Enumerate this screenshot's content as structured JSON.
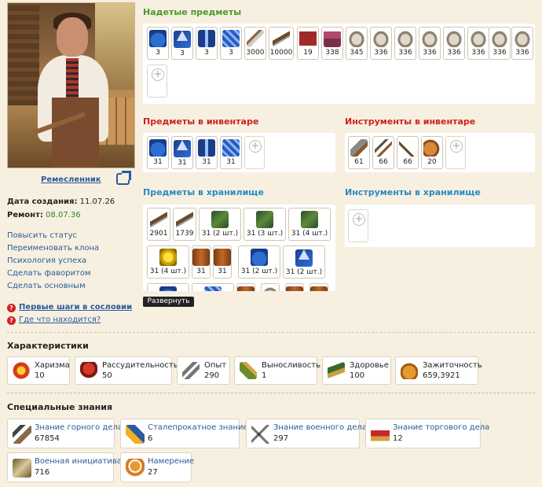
{
  "profile": {
    "class_link": "Ремесленник",
    "created_label": "Дата создания:",
    "created_value": "11.07.26",
    "repair_label": "Ремонт:",
    "repair_value": "08.07.36",
    "actions": [
      "Повысить статус",
      "Переименовать клона",
      "Психология успеха",
      "Сделать фаворитом",
      "Сделать основным"
    ],
    "help": [
      "Первые шаги в сословии",
      "Где что находится?"
    ]
  },
  "equipped": {
    "title": "Надетые предметы",
    "items": [
      {
        "icon": "blue-cap-icon",
        "count": "3"
      },
      {
        "icon": "blue-triangle-icon",
        "count": "3"
      },
      {
        "icon": "blue-vest-icon",
        "count": "3"
      },
      {
        "icon": "blue-box-icon",
        "count": "3"
      },
      {
        "icon": "sword-icon",
        "count": "3000"
      },
      {
        "icon": "rifle-icon",
        "count": "10000"
      },
      {
        "icon": "red-coat-icon",
        "count": "19"
      },
      {
        "icon": "dress-icon",
        "count": "338"
      },
      {
        "icon": "ring-icon",
        "count": "345"
      },
      {
        "icon": "ring-icon",
        "count": "336"
      },
      {
        "icon": "ring-icon",
        "count": "336"
      },
      {
        "icon": "ring-icon",
        "count": "336"
      },
      {
        "icon": "ring-icon",
        "count": "336"
      },
      {
        "icon": "ring-icon",
        "count": "336"
      },
      {
        "icon": "ring-icon",
        "count": "336"
      },
      {
        "icon": "ring-icon",
        "count": "336"
      }
    ]
  },
  "inventory": {
    "title": "Предметы в инвентаре",
    "items": [
      {
        "icon": "blue-cap-icon",
        "count": "31"
      },
      {
        "icon": "blue-triangle-icon",
        "count": "31"
      },
      {
        "icon": "blue-vest-icon",
        "count": "31"
      },
      {
        "icon": "blue-box-icon",
        "count": "31"
      }
    ]
  },
  "tools_inventory": {
    "title": "Инструменты в инвентаре",
    "items": [
      {
        "icon": "saw-icon",
        "count": "61"
      },
      {
        "icon": "pickaxe-icon",
        "count": "66"
      },
      {
        "icon": "axe-icon",
        "count": "66"
      },
      {
        "icon": "material-icon",
        "count": "20"
      }
    ]
  },
  "storage": {
    "title": "Предметы в хранилище",
    "row1": [
      {
        "icon": "rifle-icon",
        "count": "2901"
      },
      {
        "icon": "rifle-icon",
        "count": "1739"
      },
      {
        "icon": "green-item-icon",
        "count": "31 (2 шт.)"
      },
      {
        "icon": "green-item-icon",
        "count": "31 (3 шт.)"
      },
      {
        "icon": "green-item-icon",
        "count": "31 (4 шт.)"
      }
    ],
    "row2": [
      {
        "icon": "gold-item-icon",
        "count": "31 (4 шт.)"
      },
      {
        "icon": "brown-item-icon",
        "count": "31"
      },
      {
        "icon": "brown-item-icon",
        "count": "31"
      },
      {
        "icon": "blue-cap-icon",
        "count": "31 (2 шт.)"
      },
      {
        "icon": "blue-triangle-icon",
        "count": "31 (2 шт.)"
      }
    ],
    "expand": "Развернуть"
  },
  "tools_storage": {
    "title": "Инструменты в хранилище"
  },
  "characteristics": {
    "title": "Характеристики",
    "items": [
      {
        "label": "Харизма",
        "value": "10"
      },
      {
        "label": "Рассудительность",
        "value": "50"
      },
      {
        "label": "Опыт",
        "value": "290"
      },
      {
        "label": "Выносливость",
        "value": "1"
      },
      {
        "label": "Здоровье",
        "value": "100"
      },
      {
        "label": "Зажиточность",
        "value": "659,3921"
      }
    ]
  },
  "knowledge": {
    "title": "Специальные знания",
    "items": [
      {
        "label": "Знание горного дела",
        "value": "67854"
      },
      {
        "label": "Сталепрокатное знание",
        "value": "6"
      },
      {
        "label": "Знание военного дела",
        "value": "297"
      },
      {
        "label": "Знание торгового дела",
        "value": "12"
      },
      {
        "label": "Военная инициатива",
        "value": "716"
      },
      {
        "label": "Намерение",
        "value": "27"
      }
    ]
  }
}
